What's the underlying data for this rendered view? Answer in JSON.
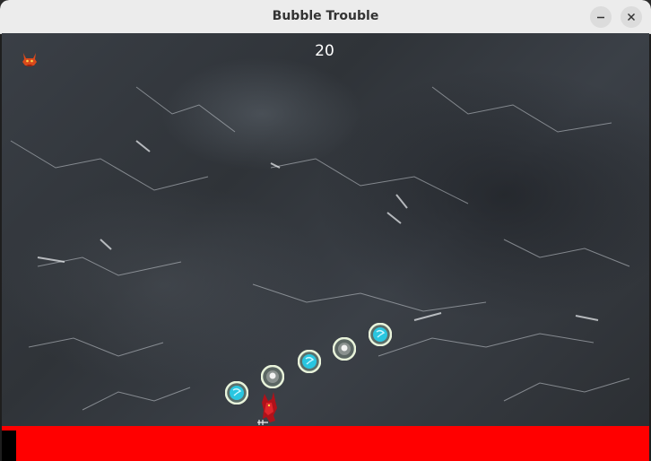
{
  "window": {
    "title": "Bubble Trouble",
    "controls": [
      "minimize-icon",
      "close-icon"
    ]
  },
  "hud": {
    "score": "20",
    "lives_icon": "devil-icon"
  },
  "colors": {
    "floor": "#ff0000",
    "timer": "#000000",
    "bubble_cyan": "#29c6e0",
    "bubble_silver": "#d8d8d8",
    "bubble_ring": "#e8f3da"
  },
  "bubbles": [
    {
      "style": "cyan"
    },
    {
      "style": "silver"
    },
    {
      "style": "cyan"
    },
    {
      "style": "silver"
    },
    {
      "style": "cyan"
    }
  ],
  "player": {
    "icon": "devil-player-icon"
  }
}
